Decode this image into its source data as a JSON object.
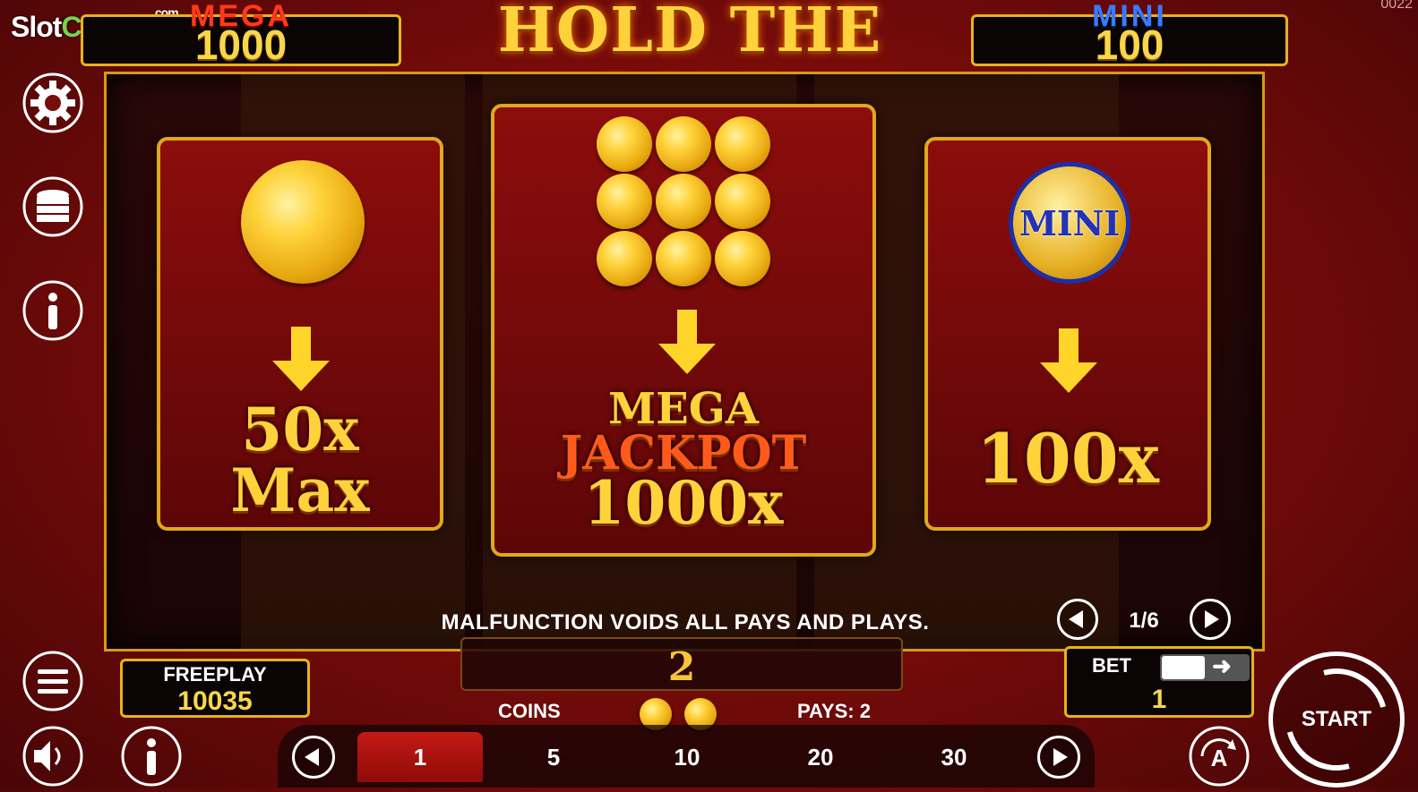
{
  "watermark": {
    "part1": "Slot",
    "part2": "Catalog",
    "suffix": ".com"
  },
  "corner_id": "0022",
  "jackpots": {
    "mega": {
      "label": "MEGA",
      "value": "1000"
    },
    "mini": {
      "label": "MINI",
      "value": "100"
    }
  },
  "title": "HOLD THE GOLD",
  "cards": {
    "left": {
      "line1": "50x",
      "line2": "Max"
    },
    "center": {
      "line1": "MEGA",
      "line2": "JACKPOT",
      "line3": "1000x"
    },
    "right": {
      "coin_label": "MINI",
      "line1": "100x"
    }
  },
  "disclaimer": "MALFUNCTION VOIDS ALL PAYS AND PLAYS.",
  "page_indicator": "1/6",
  "freeplay": {
    "label": "FREEPLAY",
    "value": "10035"
  },
  "win_value": "2",
  "coins_label": "COINS",
  "pays_label": "PAYS: 2",
  "coin_options": [
    "1",
    "5",
    "10",
    "20",
    "30"
  ],
  "selected_coin": "1",
  "bet": {
    "label": "BET",
    "value": "1"
  },
  "start_label": "START",
  "autoplay_label": "A",
  "colors": {
    "gold": "#e9b21a",
    "red_bg": "#7a0c0a",
    "card_red": "#8c0d0c",
    "mini_blue": "#1b2fa8"
  },
  "icons": [
    "settings-gear-icon",
    "coins-stack-icon",
    "info-icon",
    "menu-icon",
    "sound-icon",
    "info-icon-bottom",
    "autoplay-icon",
    "start-spin-icon"
  ]
}
